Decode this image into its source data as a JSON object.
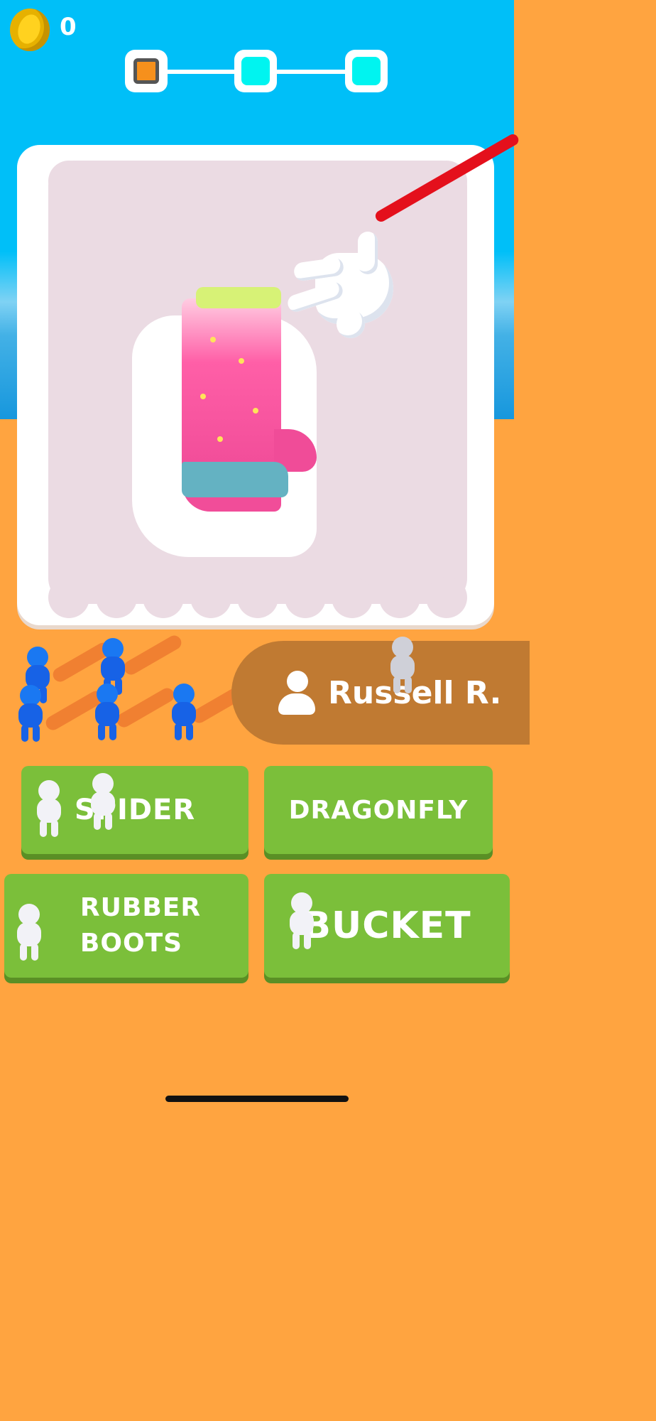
{
  "hud": {
    "coin_icon": "coin-icon",
    "coins": "0",
    "stages": [
      {
        "state": "current",
        "color": "#f6901c"
      },
      {
        "state": "pending",
        "color": "#00f4f0"
      },
      {
        "state": "pending",
        "color": "#00f4f0"
      }
    ]
  },
  "picture": {
    "subject_icon": "rubber-boot-icon",
    "tool_icon": "scratch-glove-icon"
  },
  "player": {
    "icon": "person-icon",
    "name": "Russell R."
  },
  "answers": [
    {
      "label": "SPIDER"
    },
    {
      "label": "DRAGONFLY"
    },
    {
      "label": "RUBBER\nBOOTS"
    },
    {
      "label": "BUCKET"
    }
  ],
  "colors": {
    "sky": "#00bff8",
    "ground": "#ffa440",
    "answer": "#7bbf3a",
    "player_banner": "#c07a32",
    "team_blue": "#1762e6"
  }
}
